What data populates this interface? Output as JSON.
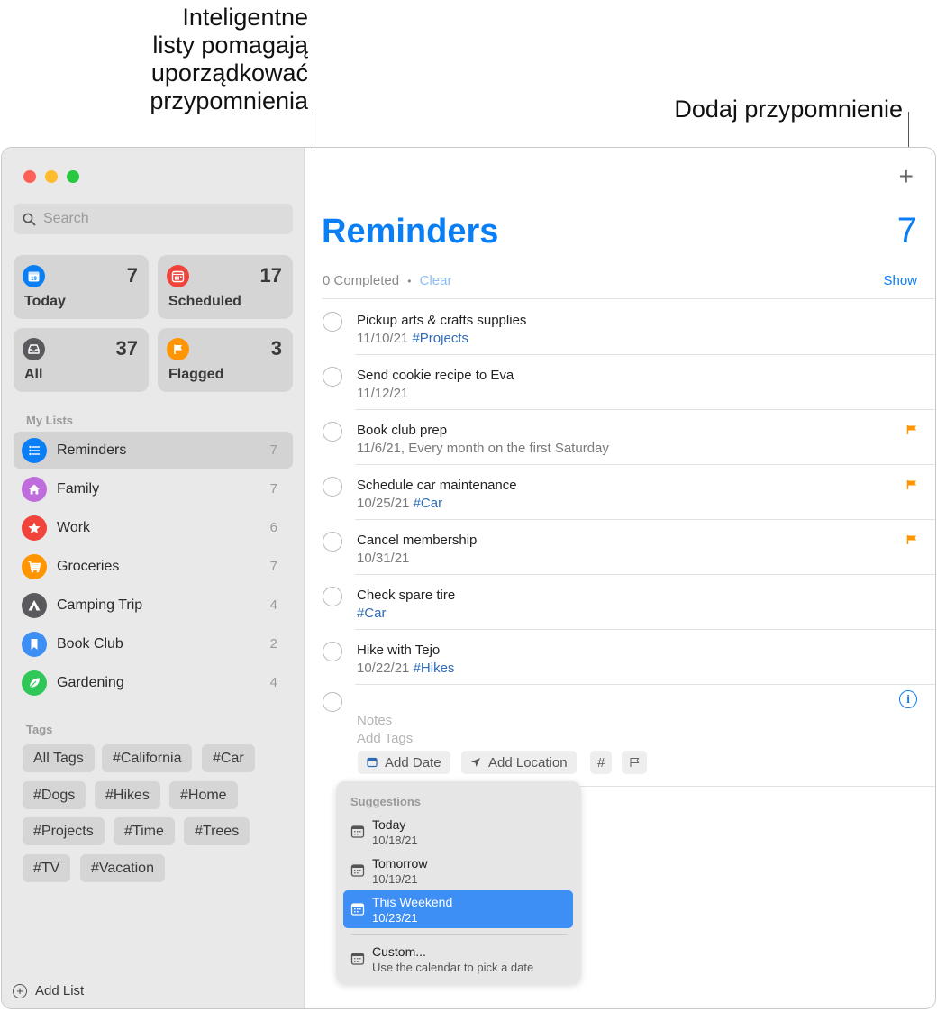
{
  "callouts": {
    "smart_lists": [
      "Inteligentne",
      "listy pomagają",
      "uporządkować",
      "przypomnienia"
    ],
    "add_reminder": "Dodaj przypomnienie"
  },
  "sidebar": {
    "search_placeholder": "Search",
    "smart_lists": [
      {
        "label": "Today",
        "count": "7",
        "color": "#0a7ff5",
        "icon": "calendar-icon"
      },
      {
        "label": "Scheduled",
        "count": "17",
        "color": "#f0433a",
        "icon": "calendar-grid-icon"
      },
      {
        "label": "All",
        "count": "37",
        "color": "#5a5a5e",
        "icon": "tray-icon"
      },
      {
        "label": "Flagged",
        "count": "3",
        "color": "#ff9500",
        "icon": "flag-icon"
      }
    ],
    "my_lists_label": "My Lists",
    "lists": [
      {
        "name": "Reminders",
        "count": "7",
        "color": "#0a7ff5",
        "icon": "list-icon"
      },
      {
        "name": "Family",
        "count": "7",
        "color": "#bf6ddc",
        "icon": "house-icon"
      },
      {
        "name": "Work",
        "count": "6",
        "color": "#f0433a",
        "icon": "star-icon"
      },
      {
        "name": "Groceries",
        "count": "7",
        "color": "#ff9500",
        "icon": "cart-icon"
      },
      {
        "name": "Camping Trip",
        "count": "4",
        "color": "#5a5a5e",
        "icon": "tent-icon"
      },
      {
        "name": "Book Club",
        "count": "2",
        "color": "#3d8ef5",
        "icon": "bookmark-icon"
      },
      {
        "name": "Gardening",
        "count": "4",
        "color": "#30c759",
        "icon": "leaf-icon"
      }
    ],
    "tags_label": "Tags",
    "tags": [
      "All Tags",
      "#California",
      "#Car",
      "#Dogs",
      "#Hikes",
      "#Home",
      "#Projects",
      "#Time",
      "#Trees",
      "#TV",
      "#Vacation"
    ],
    "add_list_label": "Add List"
  },
  "main": {
    "add_button": "+",
    "title": "Reminders",
    "count": "7",
    "completed_text": "0 Completed",
    "dot": "•",
    "clear_label": "Clear",
    "show_label": "Show",
    "reminders": [
      {
        "title": "Pickup arts & crafts supplies",
        "date": "11/10/21",
        "tag": "#Projects",
        "flagged": false
      },
      {
        "title": "Send cookie recipe to Eva",
        "date": "11/12/21",
        "tag": "",
        "flagged": false
      },
      {
        "title": "Book club prep",
        "date": "11/6/21, Every month on the first Saturday",
        "tag": "",
        "flagged": true
      },
      {
        "title": "Schedule car maintenance",
        "date": "10/25/21",
        "tag": "#Car",
        "flagged": true
      },
      {
        "title": "Cancel membership",
        "date": "10/31/21",
        "tag": "",
        "flagged": true
      },
      {
        "title": "Check spare tire",
        "date": "",
        "tag": "#Car",
        "flagged": false
      },
      {
        "title": "Hike with Tejo",
        "date": "10/22/21",
        "tag": "#Hikes",
        "flagged": false
      }
    ],
    "new_reminder": {
      "notes_placeholder": "Notes",
      "tags_placeholder": "Add Tags",
      "add_date_label": "Add Date",
      "add_location_label": "Add Location",
      "hash_label": "#"
    },
    "suggestions": {
      "title": "Suggestions",
      "items": [
        {
          "label": "Today",
          "sub": "10/18/21",
          "selected": false
        },
        {
          "label": "Tomorrow",
          "sub": "10/19/21",
          "selected": false
        },
        {
          "label": "This Weekend",
          "sub": "10/23/21",
          "selected": true
        },
        {
          "label": "Custom...",
          "sub": "Use the calendar to pick a date",
          "selected": false
        }
      ]
    }
  },
  "colors": {
    "accent": "#0a7ff5",
    "flag": "#ff9500",
    "tag_text": "#2d6bb8"
  }
}
